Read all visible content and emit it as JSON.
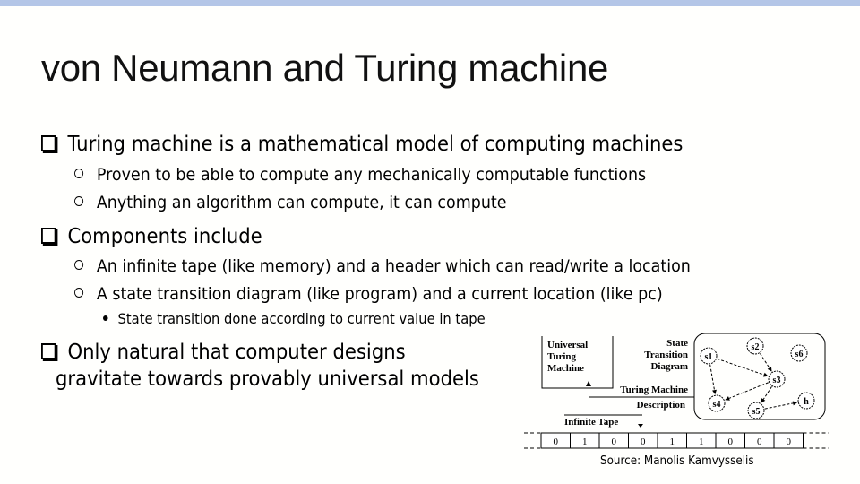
{
  "slide": {
    "title": "von Neumann and Turing machine",
    "bullets": [
      {
        "text": "Turing machine is a mathematical model of computing machines",
        "sub": [
          {
            "text": "Proven to be able to compute any mechanically computable functions"
          },
          {
            "text": "Anything an algorithm can compute, it can compute"
          }
        ]
      },
      {
        "text": "Components include",
        "sub": [
          {
            "text": "An infinite tape (like memory) and a header which can read/write a location"
          },
          {
            "text": "A state transition diagram (like program) and a current location (like pc)",
            "sub": [
              {
                "text": "State transition done according to current value in tape"
              }
            ]
          }
        ]
      },
      {
        "text": "Only natural that computer designs",
        "text2": "gravitate towards provably universal models"
      }
    ],
    "source": "Source: Manolis Kamvysselis"
  },
  "diagram": {
    "utm_label": [
      "Universal",
      "Turing",
      "Machine"
    ],
    "std_label": [
      "State",
      "Transition",
      "Diagram"
    ],
    "tm_label": "Turing Machine",
    "desc_label": "Description",
    "tape_label": "Infinite Tape",
    "states": [
      "s1",
      "s2",
      "s3",
      "s4",
      "s5",
      "s6",
      "h"
    ],
    "tape": [
      "0",
      "1",
      "0",
      "0",
      "1",
      "1",
      "0",
      "0",
      "0"
    ]
  }
}
